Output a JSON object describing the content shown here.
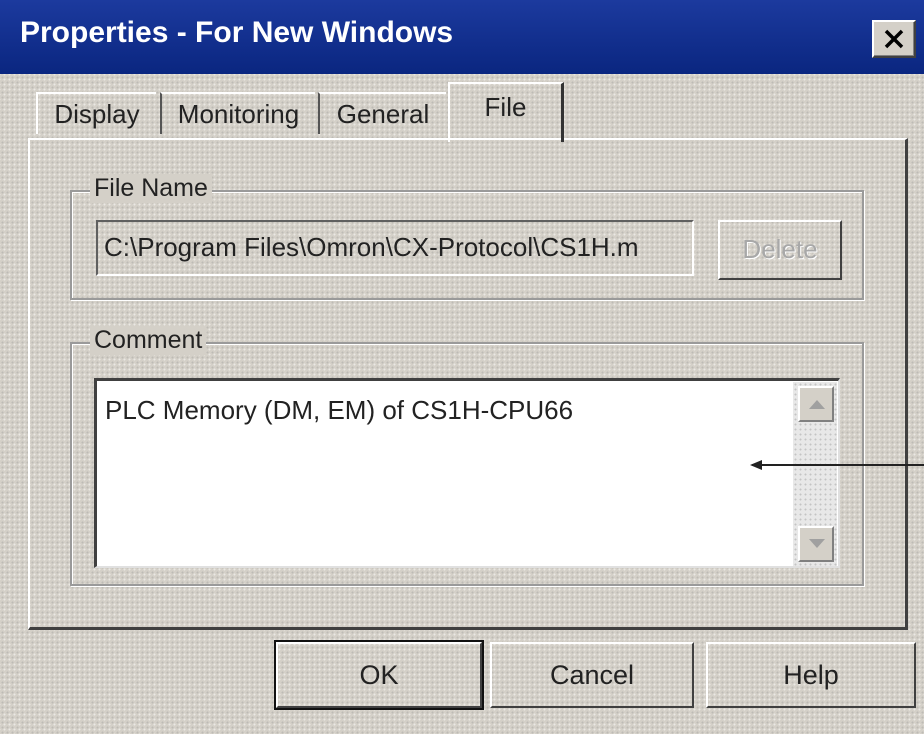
{
  "window": {
    "title": "Properties - For New Windows",
    "close_icon": "close-icon"
  },
  "tabs": [
    {
      "label": "Display",
      "selected": false
    },
    {
      "label": "Monitoring",
      "selected": false
    },
    {
      "label": "General",
      "selected": false
    },
    {
      "label": "File",
      "selected": true
    }
  ],
  "file_group": {
    "label": "File Name",
    "value": "C:\\Program Files\\Omron\\CX-Protocol\\CS1H.m",
    "delete_label": "Delete"
  },
  "comment_group": {
    "label": "Comment",
    "value": "PLC Memory (DM, EM) of CS1H-CPU66"
  },
  "buttons": {
    "ok": "OK",
    "cancel": "Cancel",
    "help": "Help"
  },
  "colors": {
    "titlebar": "#0a2680",
    "face": "#d4d0c8"
  }
}
